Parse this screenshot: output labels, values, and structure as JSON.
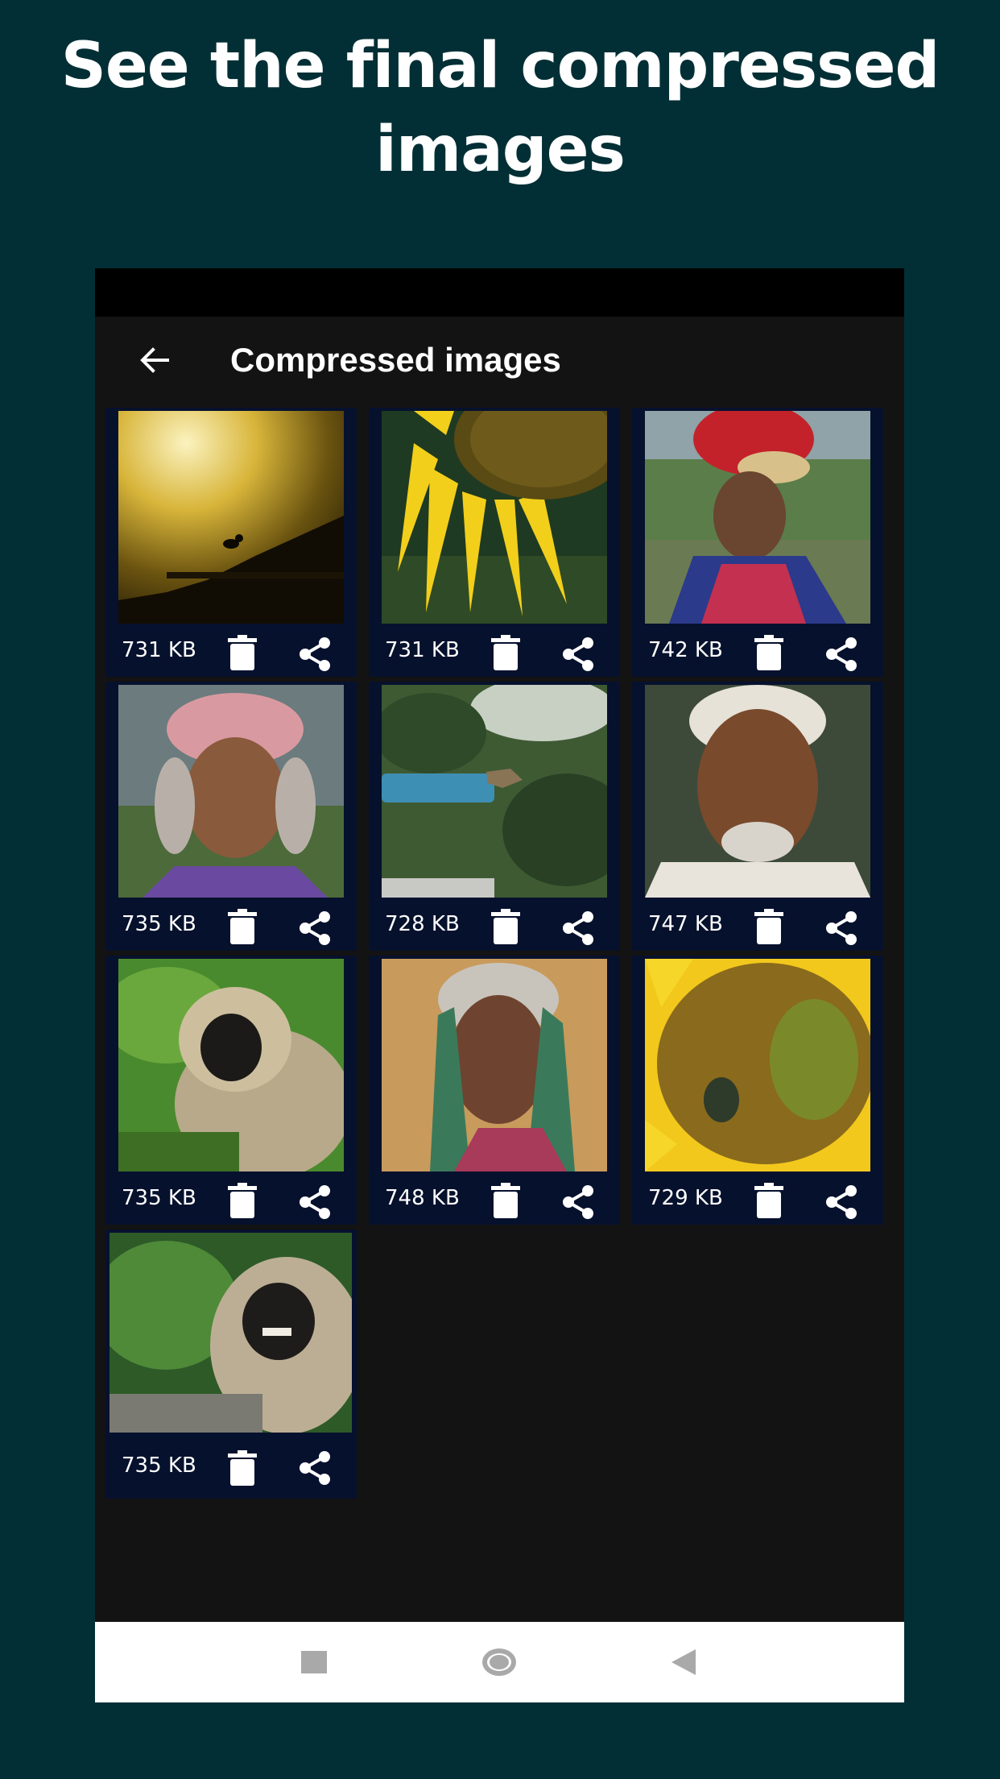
{
  "headline": {
    "line1": "See the final compressed",
    "line2": "images"
  },
  "appbar": {
    "title": "Compressed images",
    "back_icon": "arrow-left-icon"
  },
  "colors": {
    "page_background": "#022f35",
    "card_background": "#06112d",
    "screen_background": "#131313"
  },
  "images": [
    {
      "size": "731 KB",
      "subject": "bird silhouette at sunset"
    },
    {
      "size": "731 KB",
      "subject": "sunflower"
    },
    {
      "size": "742 KB",
      "subject": "woman with red headwrap"
    },
    {
      "size": "735 KB",
      "subject": "elderly woman with pink headscarf"
    },
    {
      "size": "728 KB",
      "subject": "bird on blue pipe"
    },
    {
      "size": "747 KB",
      "subject": "elderly man with white hair"
    },
    {
      "size": "735 KB",
      "subject": "langur monkey"
    },
    {
      "size": "748 KB",
      "subject": "elderly woman with checkered scarf"
    },
    {
      "size": "729 KB",
      "subject": "sunflower with insect"
    },
    {
      "size": "735 KB",
      "subject": "laughing langur monkey"
    }
  ],
  "card_icons": {
    "delete": "trash-icon",
    "share": "share-icon"
  },
  "navbar": {
    "recents": "square-icon",
    "home": "circle-icon",
    "back": "triangle-back-icon"
  }
}
